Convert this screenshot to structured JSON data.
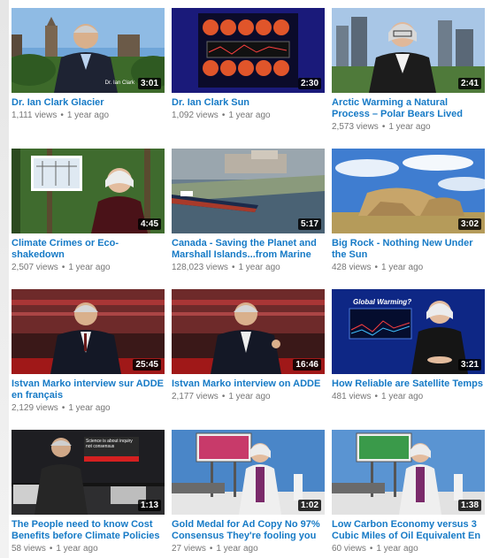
{
  "videos": [
    {
      "title": "Dr. Ian Clark Glacier",
      "duration": "3:01",
      "views": "1,111 views",
      "age": "1 year ago",
      "thumb_text": "Dr. Ian Clark"
    },
    {
      "title": "Dr. Ian Clark Sun",
      "duration": "2:30",
      "views": "1,092 views",
      "age": "1 year ago"
    },
    {
      "title": "Arctic Warming a Natural Process – Polar Bears Lived wel…",
      "duration": "2:41",
      "views": "2,573 views",
      "age": "1 year ago"
    },
    {
      "title": "Climate Crimes or Eco-shakedown",
      "duration": "4:45",
      "views": "2,507 views",
      "age": "1 year ago"
    },
    {
      "title": "Canada - Saving the Planet and Marshall Islands...from Marine",
      "duration": "5:17",
      "views": "128,023 views",
      "age": "1 year ago"
    },
    {
      "title": "Big Rock - Nothing New Under the Sun",
      "duration": "3:02",
      "views": "428 views",
      "age": "1 year ago"
    },
    {
      "title": "Istvan Marko interview sur ADDE en français",
      "duration": "25:45",
      "views": "2,129 views",
      "age": "1 year ago"
    },
    {
      "title": "Istvan Marko interview on ADDE",
      "duration": "16:46",
      "views": "2,177 views",
      "age": "1 year ago"
    },
    {
      "title": "How Reliable are Satellite Temps",
      "duration": "3:21",
      "views": "481 views",
      "age": "1 year ago",
      "thumb_text": "Global Warming?"
    },
    {
      "title": "The People need to know Cost Benefits before Climate Policies",
      "duration": "1:13",
      "views": "58 views",
      "age": "1 year ago",
      "thumb_text": "Science is about inquiry not consensus"
    },
    {
      "title": "Gold Medal for Ad Copy No 97% Consensus They're fooling you",
      "duration": "1:02",
      "views": "27 views",
      "age": "1 year ago"
    },
    {
      "title": "Low Carbon Economy versus 3 Cubic Miles of Oil Equivalent En",
      "duration": "1:38",
      "views": "60 views",
      "age": "1 year ago"
    }
  ],
  "colors": {
    "title_link": "#167ac6",
    "meta_text": "#767676",
    "duration_bg": "#000000"
  }
}
